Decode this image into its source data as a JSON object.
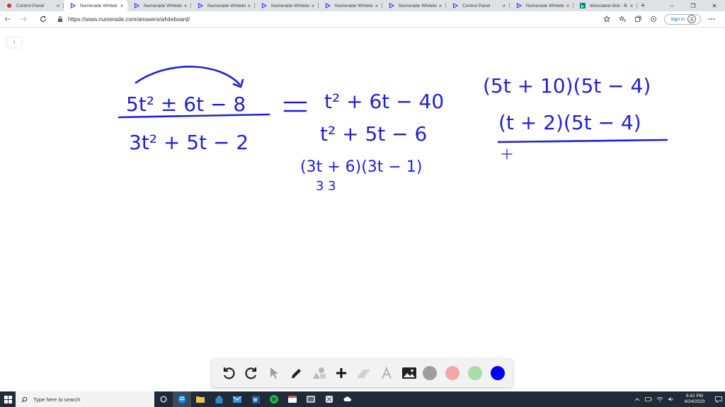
{
  "browser": {
    "tabs": [
      {
        "title": "Control Panel",
        "icon": "recording-dot-icon"
      },
      {
        "title": "Numerade Whiteb",
        "icon": "numerade-play-icon",
        "active": true
      },
      {
        "title": "Numerade Whitebo",
        "icon": "numerade-play-icon"
      },
      {
        "title": "Numerade Whitebo",
        "icon": "numerade-play-icon"
      },
      {
        "title": "Numerade Whitebo",
        "icon": "numerade-play-icon"
      },
      {
        "title": "Numerade Whitebo",
        "icon": "numerade-play-icon"
      },
      {
        "title": "Numerade Whitebo",
        "icon": "numerade-play-icon"
      },
      {
        "title": "Control Panel",
        "icon": "numerade-play-icon"
      },
      {
        "title": "Numerade Whitebo",
        "icon": "numerade-play-icon"
      },
      {
        "title": "dislocated disk - B",
        "icon": "bing-icon"
      }
    ],
    "close_glyph": "×",
    "new_tab_glyph": "+",
    "url": "https://www.numerade.com/answers/whiteboard/",
    "sign_in_label": "Sign in",
    "window_controls": {
      "minimize": "–",
      "maximize": "❐",
      "close": "✕"
    }
  },
  "whiteboard": {
    "page_number": "1",
    "handwriting": {
      "left_numerator": "5t² ± 6t − 8",
      "left_denominator": "3t² + 5t − 2",
      "equals": "=",
      "middle_line1": "t² + 6t − 40",
      "middle_line2": "t² + 5t − 6",
      "middle_line3": "(3t + 6)(3t − 1)",
      "middle_under": "3      3",
      "right_line1": "(5t + 10)(5t − 4)",
      "right_line2": "(t + 2)(5t − 4)",
      "cursor": "+"
    },
    "ink_color": "#1f1fd6",
    "palette": {
      "tools": [
        "undo-icon",
        "redo-icon",
        "pointer-icon",
        "pen-icon",
        "shapes-icon",
        "add-icon",
        "eraser-icon",
        "text-icon",
        "image-icon"
      ],
      "swatches": [
        "#9e9e9e",
        "#f2a8a8",
        "#a8dca8",
        "#0000ff"
      ]
    }
  },
  "taskbar": {
    "search_placeholder": "Type here to search",
    "time": "9:42 PM",
    "date": "4/24/2020"
  }
}
